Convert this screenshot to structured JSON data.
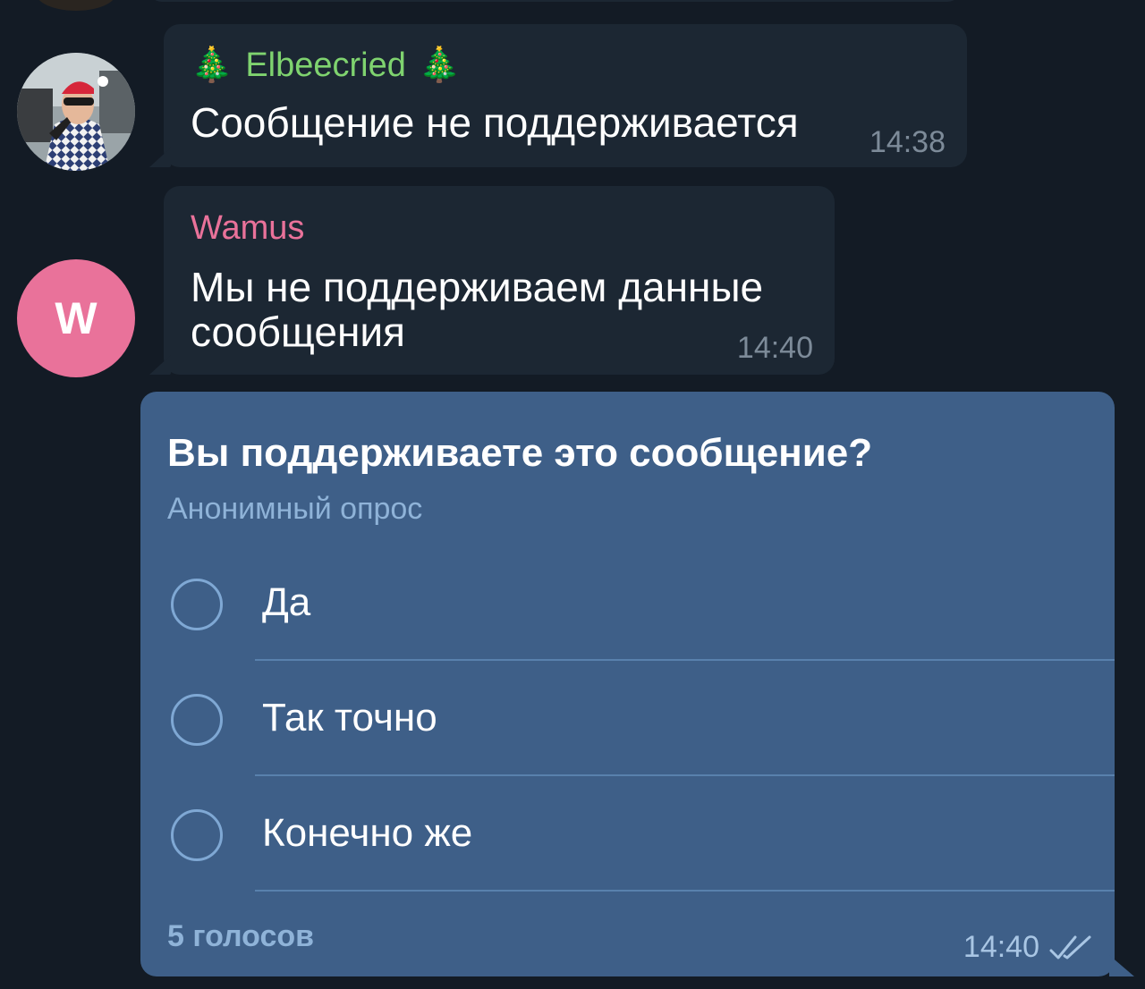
{
  "messages": [
    {
      "sender": "Elbeecried",
      "sender_emoji": "🎄",
      "text": "Сообщение не поддерживается",
      "time": "14:38",
      "avatar": "user-photo"
    },
    {
      "sender": "Wamus",
      "text": "Мы не поддерживаем данные сообщения",
      "time": "14:40",
      "avatar_letter": "W"
    }
  ],
  "poll": {
    "question": "Вы поддерживаете это сообщение?",
    "type_label": "Анонимный опрос",
    "options": [
      "Да",
      "Так точно",
      "Конечно же"
    ],
    "votes": "5 голосов",
    "time": "14:40",
    "status_icon": "double-check-icon"
  },
  "colors": {
    "background": "#131b25",
    "incoming_bubble": "#1c2733",
    "outgoing_bubble": "#3e5f88",
    "sender1": "#7fd36f",
    "sender2": "#e9729a",
    "accent": "#8fb3d8"
  }
}
